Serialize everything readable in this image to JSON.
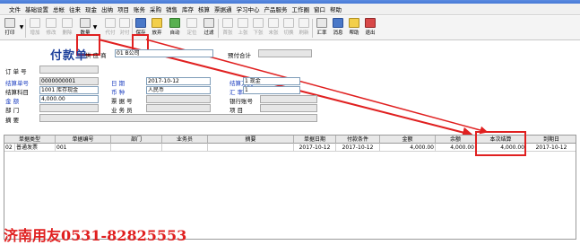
{
  "menu": [
    "文件",
    "基础设置",
    "总帐",
    "往来",
    "现金",
    "出纳",
    "项目",
    "账务",
    "采购",
    "销售",
    "库存",
    "核算",
    "票据通",
    "学习中心",
    "产品服务",
    "工作圈",
    "窗口",
    "帮助"
  ],
  "toolbar": {
    "print": "打印",
    "add": "增加",
    "modify": "修改",
    "delete": "删除",
    "void": "数量",
    "prepay": "代付",
    "save": "保存",
    "abandon": "放弃",
    "auto": "自动",
    "locate": "定位",
    "filter": "过滤",
    "first": "首张",
    "prev": "上张",
    "next": "下张",
    "last": "末张",
    "switch": "切换",
    "refresh": "刷新",
    "total": "汇率",
    "message": "消息",
    "help": "帮助",
    "exit": "退出"
  },
  "form": {
    "title": "付款单",
    "supplier_label": "供 应 商",
    "supplier_value": "01  B公司",
    "prepay_total_label": "预付合计",
    "order_no_label": "订 单 号",
    "settle_no_label": "结算单号",
    "settle_no_value": "0000000001",
    "date_label": "日    期",
    "date_value": "2017-10-12",
    "settle_method_label": "结算方式",
    "settle_method_value": "1  现金",
    "settle_subject_label": "结算科目",
    "settle_subject_value": "1001   库存现金",
    "currency_label": "币    种",
    "currency_value": "人民币",
    "rate_label": "汇    率",
    "rate_value": "1",
    "amount_label": "金    额",
    "amount_value": "4,000.00",
    "ticket_label": "票 据 号",
    "bank_label": "银行账号",
    "dept_label": "部    门",
    "staff_label": "业 务 员",
    "project_label": "项    目",
    "summary_label": "摘    要"
  },
  "grid": {
    "columns": [
      "单据类型",
      "单据编号",
      "部门",
      "业务员",
      "摘要",
      "单据日期",
      "付款条件",
      "金额",
      "余额",
      "本次结算",
      "到期日"
    ],
    "rows": [
      {
        "seq": "02",
        "type": "普通发票",
        "no": "001",
        "dept": "",
        "staff": "",
        "summary": "",
        "date": "2017-10-12",
        "terms": "2017-10-12",
        "amount": "4,000.00",
        "balance": "4,000.00",
        "settle": "4,000.00",
        "due": "2017-10-12"
      }
    ]
  },
  "watermark": "济南用友0531-82825553",
  "colors": {
    "highlight": "#e02020",
    "accent_blue": "#1d3fc0"
  }
}
